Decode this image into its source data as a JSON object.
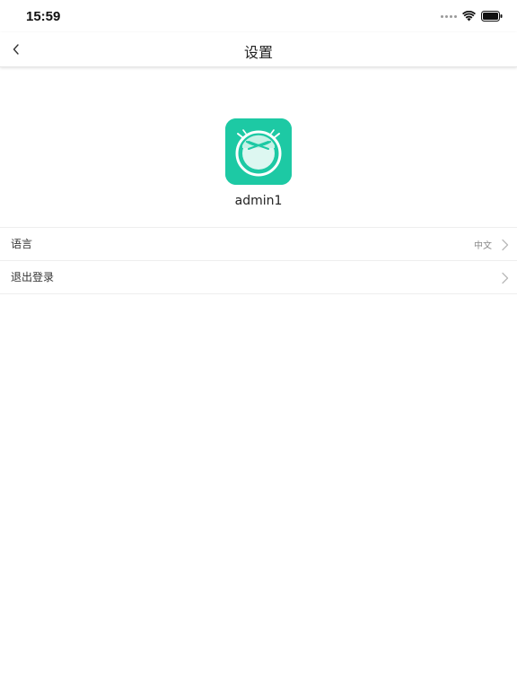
{
  "status_bar": {
    "time": "15:59",
    "icons": [
      "signal-dots-icon",
      "wifi-icon",
      "battery-icon"
    ]
  },
  "nav": {
    "title": "设置",
    "back_icon": "chevron-left-icon"
  },
  "profile": {
    "logo_icon": "robot-vacuum-logo-icon",
    "username": "admin1",
    "accent_color": "#1dc9a4"
  },
  "settings": {
    "items": [
      {
        "label": "语言",
        "value": "中文",
        "icon": "chevron-right-icon"
      },
      {
        "label": "退出登录",
        "value": "",
        "icon": "chevron-right-icon"
      }
    ]
  }
}
